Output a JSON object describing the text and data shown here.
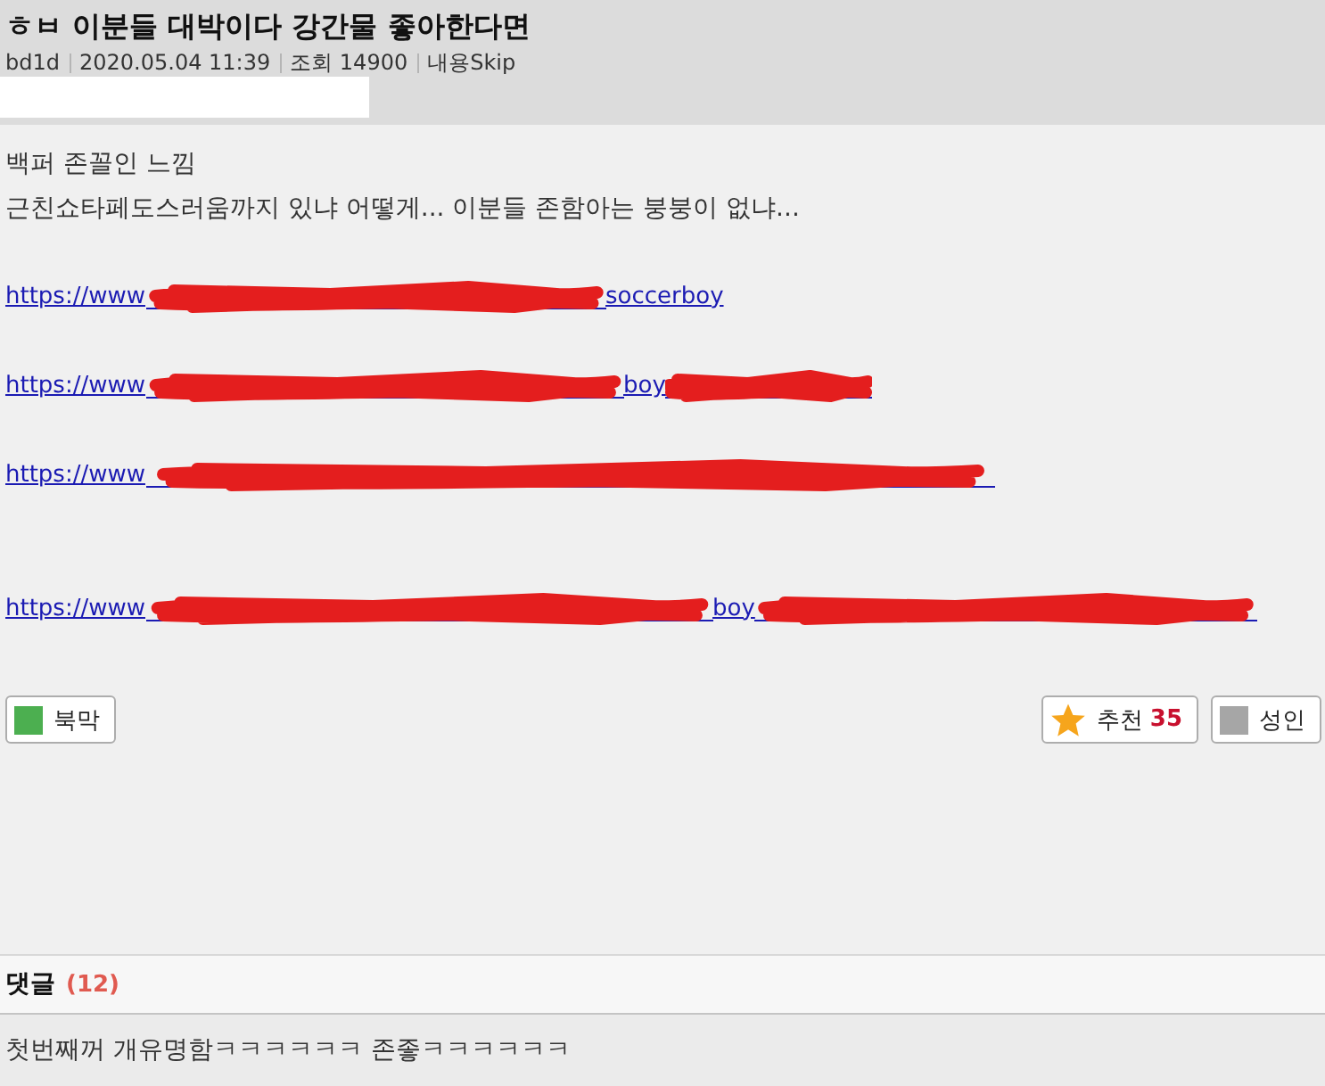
{
  "post": {
    "title": "ㅎㅂ 이분들 대박이다 강간물 좋아한다면",
    "author": "bd1d",
    "date": "2020.05.04 11:39",
    "views": "조회 14900",
    "content_tag": "내용Skip"
  },
  "body": {
    "lines": [
      "백퍼 존꼴인 느낌",
      "근친쇼타페도스러움까지 있냐 어떻게... 이분들 존함아는 붕붕이 없냐..."
    ],
    "links": [
      {
        "parts": [
          {
            "kind": "text",
            "text": "https://www"
          },
          {
            "kind": "redacted"
          },
          {
            "kind": "text",
            "text": "soccerboy"
          }
        ]
      },
      {
        "parts": [
          {
            "kind": "text",
            "text": "https://www"
          },
          {
            "kind": "redacted"
          },
          {
            "kind": "text",
            "text": "boy"
          },
          {
            "kind": "redacted"
          }
        ]
      },
      {
        "parts": [
          {
            "kind": "text",
            "text": "https://www"
          },
          {
            "kind": "redacted"
          }
        ]
      },
      {
        "parts": [
          {
            "kind": "text",
            "text": "https://www"
          },
          {
            "kind": "redacted"
          },
          {
            "kind": "text",
            "text": "boy"
          },
          {
            "kind": "redacted"
          }
        ]
      }
    ]
  },
  "actions": {
    "left": [
      {
        "kind": "swatch",
        "label": "북막",
        "color": "#4caf50"
      }
    ],
    "right": [
      {
        "kind": "star",
        "label": "추천",
        "count": "35"
      },
      {
        "kind": "swatch",
        "label": "성인",
        "color": "#a6a6a6"
      }
    ]
  },
  "comments": {
    "title": "댓글",
    "count": "(12)",
    "items": [
      {
        "text": "첫번째꺼 개유명함ㅋㅋㅋㅋㅋㅋ 존좋ㅋㅋㅋㅋㅋㅋ"
      }
    ]
  }
}
